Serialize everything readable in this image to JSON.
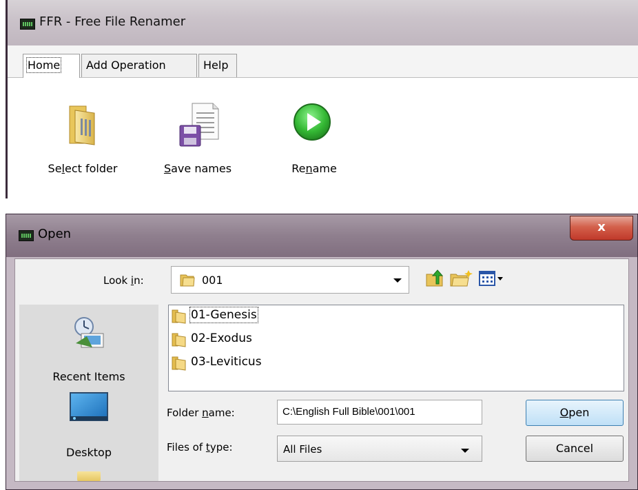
{
  "ffr_window": {
    "title": "FFR - Free File Renamer",
    "tabs": [
      {
        "label": "Home",
        "active": true
      },
      {
        "label": "Add Operation",
        "active": false
      },
      {
        "label": "Help",
        "active": false
      }
    ],
    "buttons": [
      {
        "label_pre": "Se",
        "label_u": "l",
        "label_post": "ect folder",
        "icon": "folder-icon"
      },
      {
        "label_pre": "",
        "label_u": "S",
        "label_post": "ave names",
        "icon": "save-document-icon"
      },
      {
        "label_pre": "Re",
        "label_u": "n",
        "label_post": "ame",
        "icon": "play-icon"
      }
    ]
  },
  "open_dialog": {
    "title": "Open",
    "close_label": "x",
    "look_in": {
      "label_pre": "Look ",
      "label_u": "i",
      "label_post": "n:",
      "value": "001"
    },
    "places": [
      {
        "label": "Recent Items",
        "icon": "recent-items-icon"
      },
      {
        "label": "Desktop",
        "icon": "desktop-icon"
      }
    ],
    "files": [
      {
        "name": "01-Genesis",
        "focused": true
      },
      {
        "name": "02-Exodus",
        "focused": false
      },
      {
        "name": "03-Leviticus",
        "focused": false
      }
    ],
    "folder_name": {
      "label_pre": "Folder ",
      "label_u": "n",
      "label_post": "ame:",
      "value": "C:\\English Full Bible\\001\\001"
    },
    "files_of_type": {
      "label_pre": "Files of ",
      "label_u": "t",
      "label_post": "ype:",
      "value": "All Files"
    },
    "open_button": {
      "label_u": "O",
      "label_post": "pen"
    },
    "cancel_button": {
      "label": "Cancel"
    },
    "colors": {
      "accent": "#3c7fb1",
      "title_bar": "#8f7f8e",
      "close": "#c0392a"
    }
  }
}
